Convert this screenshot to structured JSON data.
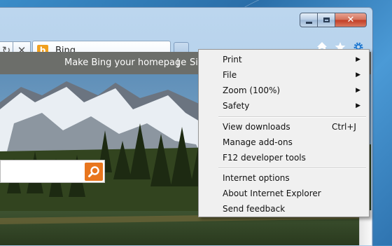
{
  "window": {
    "caption": {
      "close_glyph": "✕"
    }
  },
  "nav": {
    "refresh_glyph": "↻",
    "stop_glyph": "✕"
  },
  "tab": {
    "logo_letter": "b",
    "title": "Bing"
  },
  "toolbar": {
    "icons": [
      "home-icon",
      "favorites-star-icon",
      "tools-gear-icon"
    ]
  },
  "page": {
    "header_link": "Make Bing your homepage",
    "separator": "|",
    "next_link_partial": "Si"
  },
  "menu": {
    "items": [
      {
        "label": "Print",
        "has_submenu": true
      },
      {
        "label": "File",
        "has_submenu": true
      },
      {
        "label": "Zoom (100%)",
        "has_submenu": true
      },
      {
        "label": "Safety",
        "has_submenu": true
      },
      {
        "label": "View downloads",
        "shortcut": "Ctrl+J"
      },
      {
        "label": "Manage add-ons"
      },
      {
        "label": "F12 developer tools"
      },
      {
        "label": "Internet options"
      },
      {
        "label": "About Internet Explorer"
      },
      {
        "label": "Send feedback"
      }
    ]
  },
  "colors": {
    "accent_blue": "#2a6ea8",
    "bing_orange": "#e8761e",
    "close_red": "#c13c24",
    "menu_bg": "#f0f0f0"
  }
}
